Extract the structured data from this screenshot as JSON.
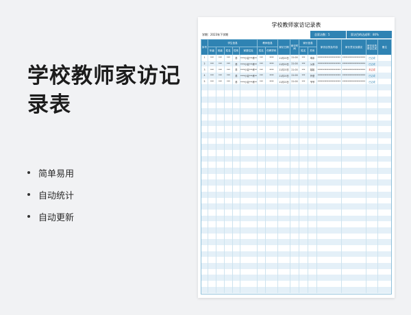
{
  "hero": {
    "title": "学校教师家访记录表"
  },
  "features": [
    {
      "label": "简单易用"
    },
    {
      "label": "自动统计"
    },
    {
      "label": "自动更新"
    }
  ],
  "document": {
    "title": "学校教师家访记录表",
    "period": "学期：2023年下学期",
    "stat_count": "总家访数：5",
    "stat_rate": "家访目的达成率：80%",
    "headers": {
      "seq": "序号",
      "student_group": "学生信息",
      "student_cols": [
        "年级",
        "班级",
        "姓名",
        "性别",
        "家庭住址"
      ],
      "teacher_group": "教师信息",
      "teacher_cols": [
        "姓名",
        "任教学科"
      ],
      "visit_date": "家访日期",
      "visit_time": "家访时间",
      "parent_group": "家长信息",
      "parent_cols": [
        "姓名",
        "关系"
      ],
      "purpose": "家访目的及内容",
      "feedback": "家长意见及建议",
      "achieved": "家访目的是否达成",
      "remark": "备注"
    },
    "rows": [
      {
        "seq": "1",
        "grade": "***",
        "cls": "***",
        "name": "***",
        "gender": "男",
        "addr": "*****小区***栋***",
        "tname": "***",
        "subject": "****",
        "date": "11月20日",
        "time": "21:00",
        "pname": "***",
        "relation": "母亲",
        "purpose": "*********************",
        "feedback": "*********************",
        "achieved": "已达成",
        "status": "done"
      },
      {
        "seq": "2",
        "grade": "***",
        "cls": "***",
        "name": "***",
        "gender": "男",
        "addr": "*****小区***栋***",
        "tname": "***",
        "subject": "****",
        "date": "11月20日",
        "time": "21:00",
        "pname": "***",
        "relation": "父亲",
        "purpose": "*********************",
        "feedback": "*********************",
        "achieved": "已达成",
        "status": "done"
      },
      {
        "seq": "3",
        "grade": "***",
        "cls": "***",
        "name": "***",
        "gender": "男",
        "addr": "*****小区***栋***",
        "tname": "***",
        "subject": "****",
        "date": "11月20日",
        "time": "21:00",
        "pname": "***",
        "relation": "姐姐",
        "purpose": "*********************",
        "feedback": "*********************",
        "achieved": "未达成",
        "status": "pending"
      },
      {
        "seq": "4",
        "grade": "***",
        "cls": "***",
        "name": "***",
        "gender": "男",
        "addr": "*****小区***栋***",
        "tname": "***",
        "subject": "****",
        "date": "11月20日",
        "time": "21:00",
        "pname": "***",
        "relation": "外婆",
        "purpose": "*********************",
        "feedback": "*********************",
        "achieved": "已达成",
        "status": "done"
      },
      {
        "seq": "5",
        "grade": "***",
        "cls": "***",
        "name": "***",
        "gender": "男",
        "addr": "*****小区***栋***",
        "tname": "***",
        "subject": "****",
        "date": "11月20日",
        "time": "21:00",
        "pname": "***",
        "relation": "爷爷",
        "purpose": "*********************",
        "feedback": "*********************",
        "achieved": "已达成",
        "status": "done"
      }
    ],
    "accent_color": "#2f83b3",
    "pending_color": "#d33a2f"
  }
}
